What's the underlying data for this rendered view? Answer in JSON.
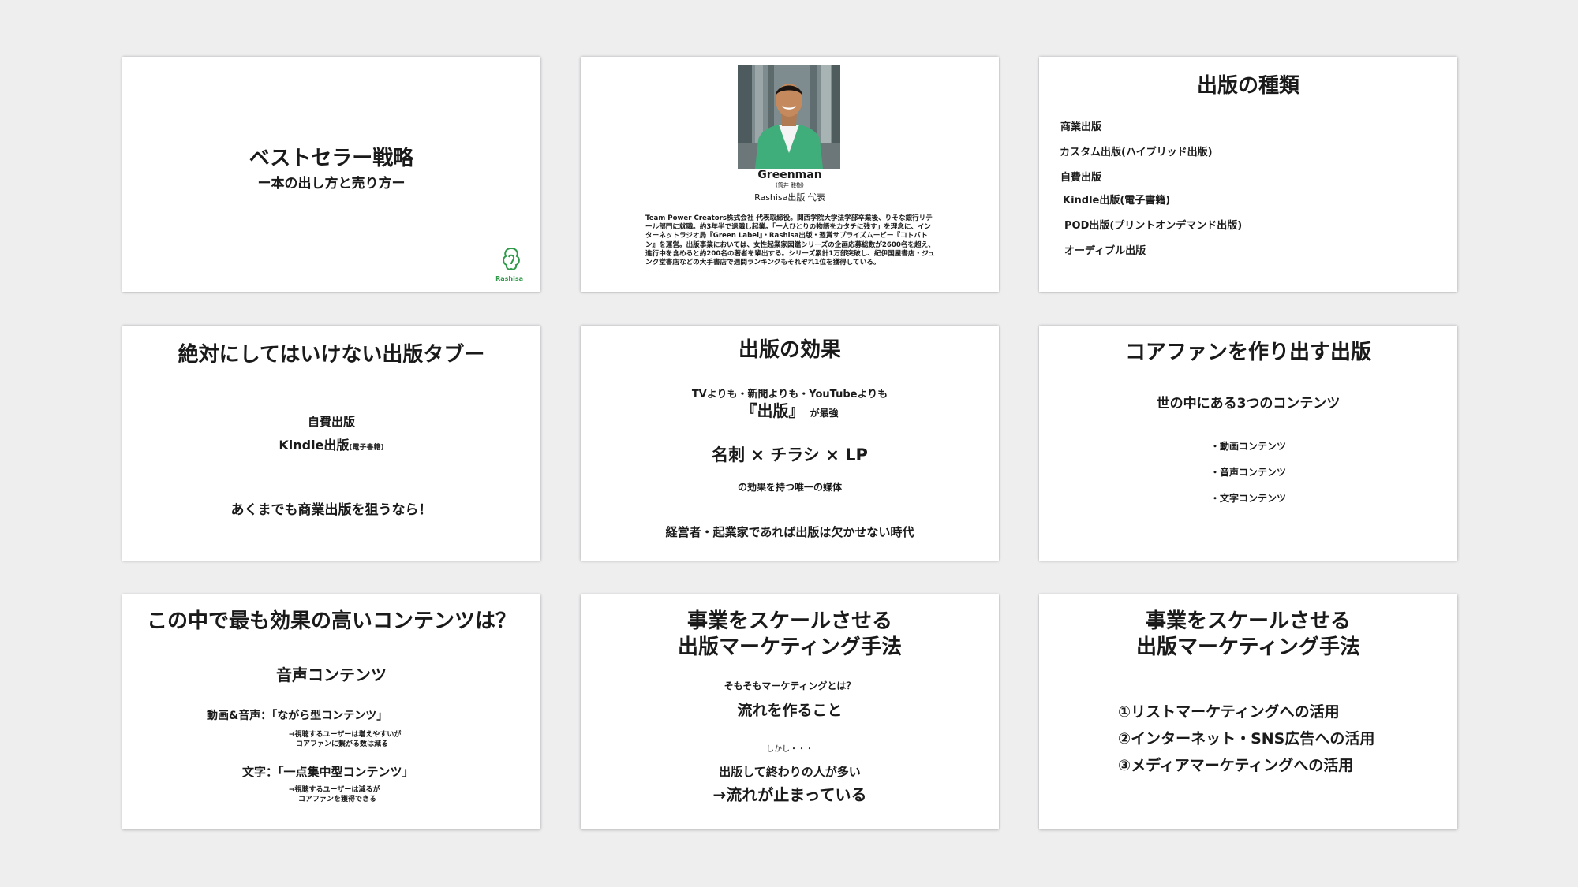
{
  "slide1": {
    "title": "ベストセラー戦略",
    "subtitle": "ー本の出し方と売り方ー",
    "logo_text": "Rashisa",
    "logo_icon": "rashisa-logo-icon"
  },
  "slide2": {
    "name": "Greenman",
    "name_kana": "(筒井 雅樹)",
    "role": "Rashisa出版 代表",
    "bio": "Team Power Creators株式会社 代表取締役。関西学院大学法学部卒業後、りそな銀行リテール部門に就職。約3年半で退職し起業。「一人ひとりの物語をカタチに残す」を理念に、インターネットラジオ局『Green Label』・Rashisa出版・週賞サプライズムービー『コトバトン』を運営。出版事業においては、女性起業家図鑑シリーズの企画応募総数が2600名を超え、進行中を含めると約200名の著者を輩出する。シリーズ累計1万部突破し、紀伊国屋書店・ジュンク堂書店などの大手書店で週間ランキングもそれぞれ1位を獲得している。"
  },
  "slide3": {
    "title": "出版の種類",
    "items": [
      "商業出版",
      "カスタム出版(ハイブリッド出版)",
      "自費出版",
      "Kindle出版(電子書籍)",
      "POD出版(プリントオンデマンド出版)",
      "オーディブル出版"
    ]
  },
  "slide4": {
    "title": "絶対にしてはいけない出版タブー",
    "line1": "自費出版",
    "line2_main": "Kindle出版",
    "line2_small": "(電子書籍)",
    "line3": "あくまでも商業出版を狙うなら！"
  },
  "slide5": {
    "title": "出版の効果",
    "line1": "TVよりも・新聞よりも・YouTubeよりも",
    "line2_main": "『出版』",
    "line2_small": "が最強",
    "line3": "名刺 × チラシ × LP",
    "line4": "の効果を持つ唯一の媒体",
    "line5": "経営者・起業家であれば出版は欠かせない時代"
  },
  "slide6": {
    "title": "コアファンを作り出す出版",
    "subtitle": "世の中にある3つのコンテンツ",
    "bullets": [
      "・動画コンテンツ",
      "・音声コンテンツ",
      "・文字コンテンツ"
    ]
  },
  "slide7": {
    "title": "この中で最も効果の高いコンテンツは？",
    "answer": "音声コンテンツ",
    "a_label": "動画&音声：「ながら型コンテンツ」",
    "a_note1": "→視聴するユーザーは増えやすいが",
    "a_note2": "コアファンに繋がる数は減る",
    "b_label": "文字：「一点集中型コンテンツ」",
    "b_note1": "→視聴するユーザーは減るが",
    "b_note2": "コアファンを獲得できる"
  },
  "slide8": {
    "title_line1": "事業をスケールさせる",
    "title_line2": "出版マーケティング手法",
    "question": "そもそもマーケティングとは？",
    "answer": "流れを作ること",
    "however": "しかし・・・",
    "line4": "出版して終わりの人が多い",
    "line5": "→流れが止まっている"
  },
  "slide9": {
    "title_line1": "事業をスケールさせる",
    "title_line2": "出版マーケティング手法",
    "items": [
      "①リストマーケティングへの活用",
      "②インターネット・SNS広告への活用",
      "③メディアマーケティングへの活用"
    ]
  },
  "colors": {
    "background": "#eeeeef",
    "slide": "#ffffff",
    "text": "#1a1a1a",
    "logo_green": "#2f9a4a",
    "jacket_green": "#3fae7a"
  }
}
